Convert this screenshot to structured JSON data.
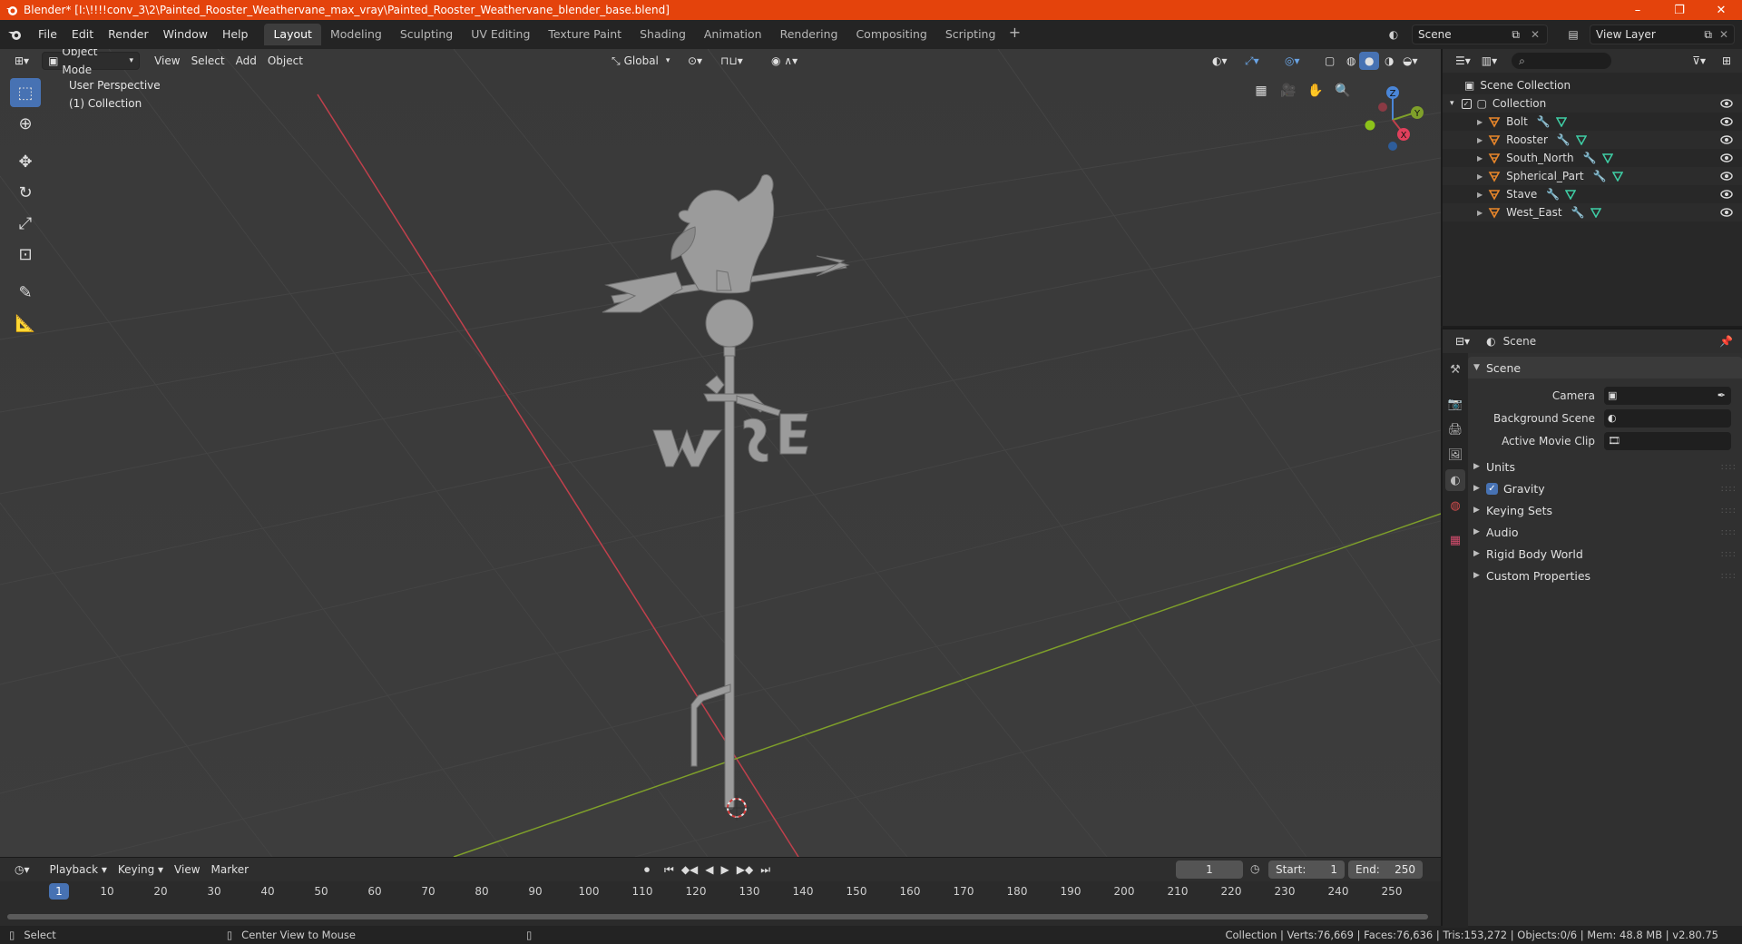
{
  "window": {
    "title": "Blender* [I:\\!!!!conv_3\\2\\Painted_Rooster_Weathervane_max_vray\\Painted_Rooster_Weathervane_blender_base.blend]",
    "minimize": "–",
    "maximize": "❐",
    "close": "✕"
  },
  "menu": [
    "File",
    "Edit",
    "Render",
    "Window",
    "Help"
  ],
  "workspaces": [
    "Layout",
    "Modeling",
    "Sculpting",
    "UV Editing",
    "Texture Paint",
    "Shading",
    "Animation",
    "Rendering",
    "Compositing",
    "Scripting"
  ],
  "workspace_add": "+",
  "scene_selector": "Scene",
  "view_layer": "View Layer",
  "viewport": {
    "mode": "Object Mode",
    "menus": [
      "View",
      "Select",
      "Add",
      "Object"
    ],
    "transform_orientation": "Global",
    "perspective_label": "User Perspective",
    "collection_label": "(1) Collection",
    "gizmo": {
      "x": "X",
      "y": "Y",
      "z": "Z"
    }
  },
  "timeline": {
    "menus": [
      "Playback",
      "Keying",
      "View",
      "Marker"
    ],
    "current_frame": "1",
    "start_label": "Start:",
    "start": "1",
    "end_label": "End:",
    "end": "250",
    "ticks": [
      "10",
      "20",
      "30",
      "40",
      "50",
      "60",
      "70",
      "80",
      "90",
      "100",
      "110",
      "120",
      "130",
      "140",
      "150",
      "160",
      "170",
      "180",
      "190",
      "200",
      "210",
      "220",
      "230",
      "240",
      "250"
    ],
    "playhead": "1"
  },
  "statusbar": {
    "left": "Select",
    "middle": "Center View to Mouse",
    "stats": "Collection | Verts:76,669 | Faces:76,636 | Tris:153,272 | Objects:0/6 | Mem: 48.8 MB | v2.80.75"
  },
  "outliner": {
    "root": "Scene Collection",
    "collection": "Collection",
    "objects": [
      "Bolt",
      "Rooster",
      "South_North",
      "Spherical_Part",
      "Stave",
      "West_East"
    ]
  },
  "properties": {
    "context": "Scene",
    "panel_title": "Scene",
    "fields": [
      {
        "label": "Camera"
      },
      {
        "label": "Background Scene"
      },
      {
        "label": "Active Movie Clip"
      }
    ],
    "subpanels": [
      "Units",
      "Gravity",
      "Keying Sets",
      "Audio",
      "Rigid Body World",
      "Custom Properties"
    ]
  },
  "colors": {
    "title_bar": "#e4430c",
    "accent": "#4772b3",
    "x_axis": "#c0404c",
    "y_axis": "#7fa02a",
    "z_axis": "#4a86d8",
    "object_icon": "#e8862a"
  }
}
